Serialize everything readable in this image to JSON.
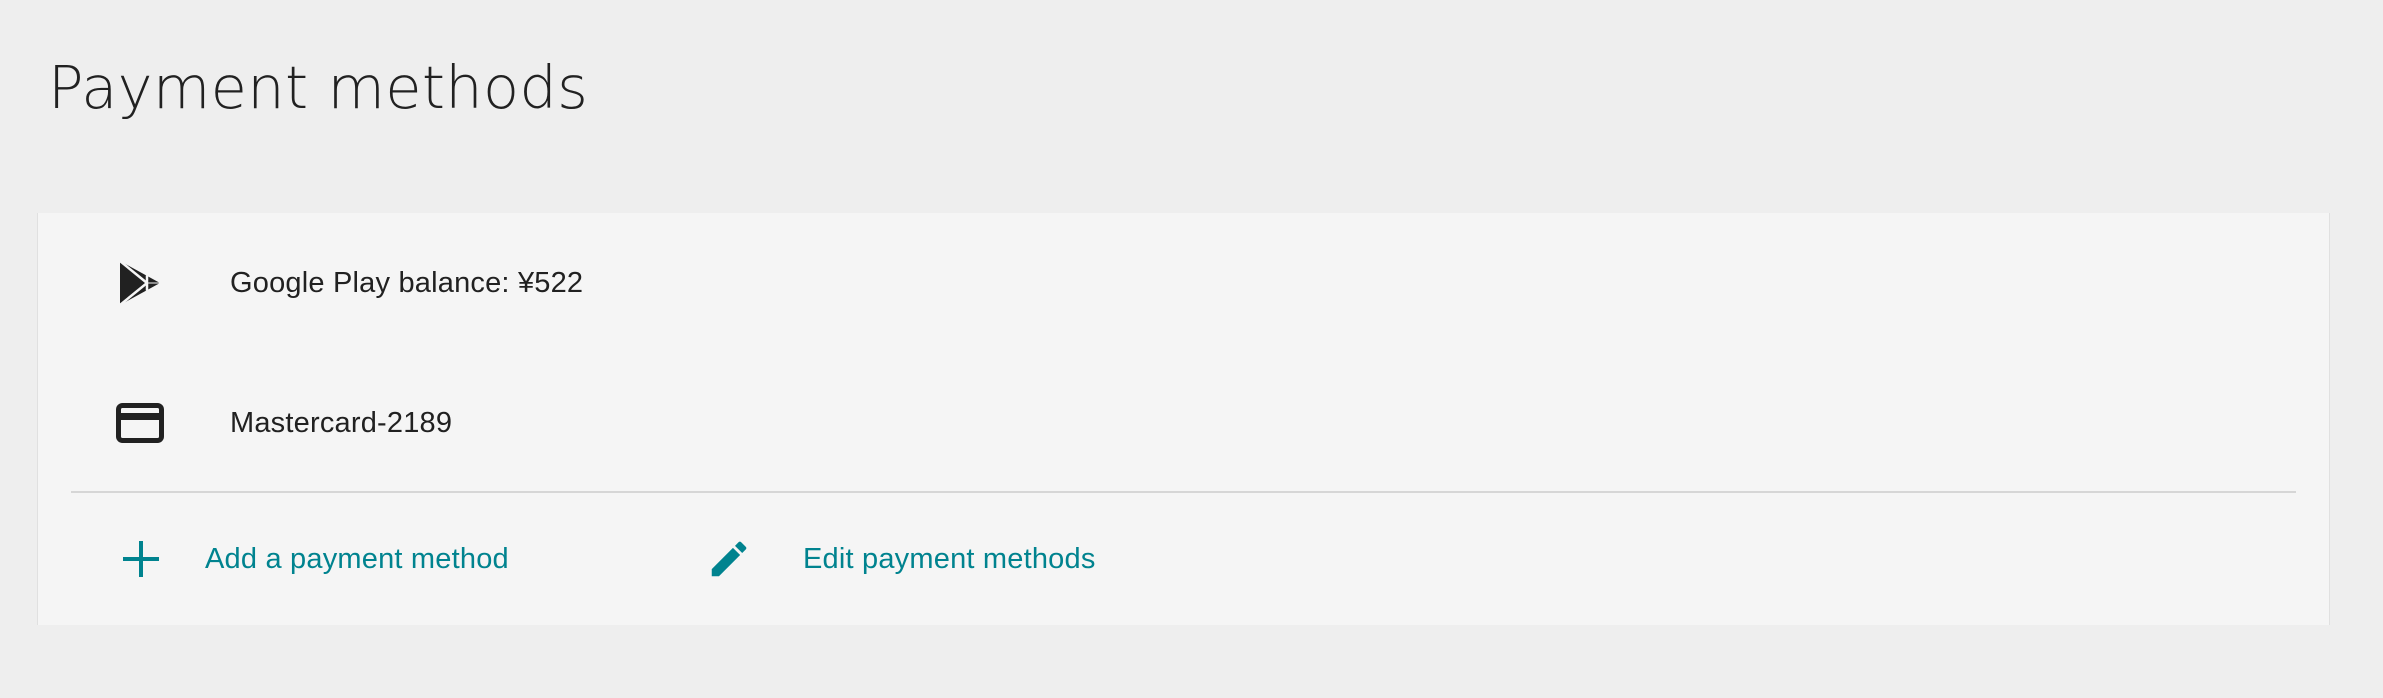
{
  "page": {
    "title": "Payment methods"
  },
  "payment_methods": [
    {
      "icon": "google-play-icon",
      "label": "Google Play balance: ¥522"
    },
    {
      "icon": "credit-card-icon",
      "label": "Mastercard-2189"
    }
  ],
  "actions": {
    "add": {
      "icon": "plus-icon",
      "label": "Add a payment method"
    },
    "edit": {
      "icon": "pencil-icon",
      "label": "Edit payment methods"
    }
  },
  "colors": {
    "background": "#eeeeee",
    "card": "#f5f5f5",
    "text": "#212121",
    "accent": "#00838f"
  }
}
